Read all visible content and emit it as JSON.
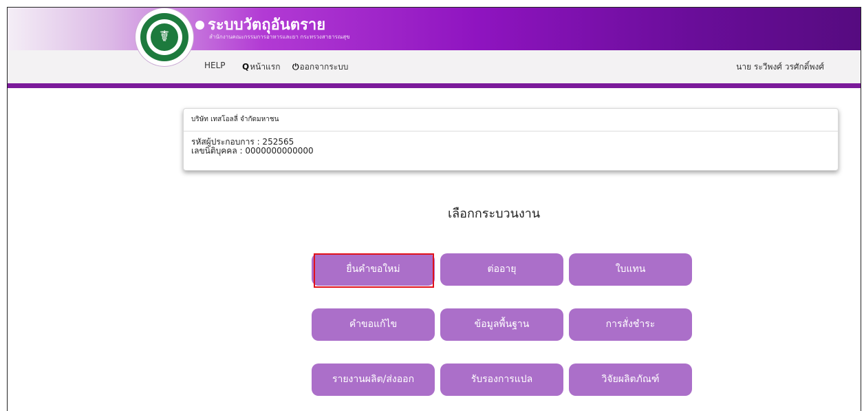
{
  "app": {
    "title": "ระบบวัตถุอันตราย",
    "subtitle": "สำนักงานคณะกรรมการอาหารและยา กระทรวงสาธารณสุข",
    "logo_symbol": "☤"
  },
  "nav": {
    "help": "HELP",
    "home_icon": "Q",
    "home": "หน้าแรก",
    "logout_icon": "⏻",
    "logout": "ออกจากระบบ",
    "user": "นาย ระวีพงศ์ วรศักดิ์พงศ์"
  },
  "company": {
    "name": "บริษัท เทสโอลลี่ จำกัดมหาชน",
    "operator_code": "รหัสผู้ประกอบการ : 252565",
    "juristic_id": "เลขนิติบุคคล : 0000000000000"
  },
  "section_title": "เลือกกระบวนงาน",
  "buttons": {
    "new_request": "ยื่นคำขอใหม่",
    "renew": "ต่ออายุ",
    "replacement": "ใบแทน",
    "amend": "คำขอแก้ไข",
    "basic_info": "ข้อมูลพื้นฐาน",
    "payment_order": "การสั่งชำระ",
    "production_report": "รายงานผลิต/ส่งออก",
    "translation_cert": "รับรองการแปล",
    "product_research": "วิจัยผลิตภัณฑ์"
  },
  "colors": {
    "accent_purple": "#8f14c0",
    "button_purple": "#ab6fc9",
    "highlight_red": "#e0101a"
  }
}
